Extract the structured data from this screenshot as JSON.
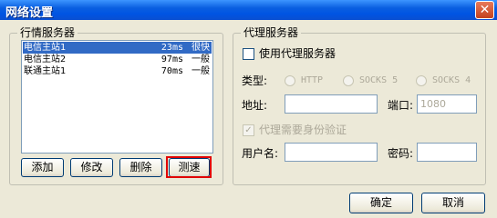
{
  "window": {
    "title": "网络设置",
    "close_glyph": "✕"
  },
  "quote_servers": {
    "legend": "行情服务器",
    "rows": [
      {
        "name": "电信主站1",
        "latency": "23ms",
        "status": "很快",
        "selected": true
      },
      {
        "name": "电信主站2",
        "latency": "97ms",
        "status": "一般",
        "selected": false
      },
      {
        "name": "联通主站1",
        "latency": "70ms",
        "status": "一般",
        "selected": false
      }
    ],
    "buttons": {
      "add": "添加",
      "edit": "修改",
      "delete": "删除",
      "test": "测速"
    }
  },
  "proxy": {
    "legend": "代理服务器",
    "use_proxy_label": "使用代理服务器",
    "type_label": "类型:",
    "type_options": [
      "HTTP",
      "SOCKS 5",
      "SOCKS 4"
    ],
    "address_label": "地址:",
    "address_value": "",
    "port_label": "端口:",
    "port_value": "1080",
    "auth_label": "代理需要身份验证",
    "auth_check_glyph": "✓",
    "username_label": "用户名:",
    "username_value": "",
    "password_label": "密码:",
    "password_value": ""
  },
  "footer": {
    "ok": "确定",
    "cancel": "取消"
  },
  "colors": {
    "selection": "#316AC5",
    "highlight_border": "#e00000",
    "titlebar": "#0054e3"
  }
}
